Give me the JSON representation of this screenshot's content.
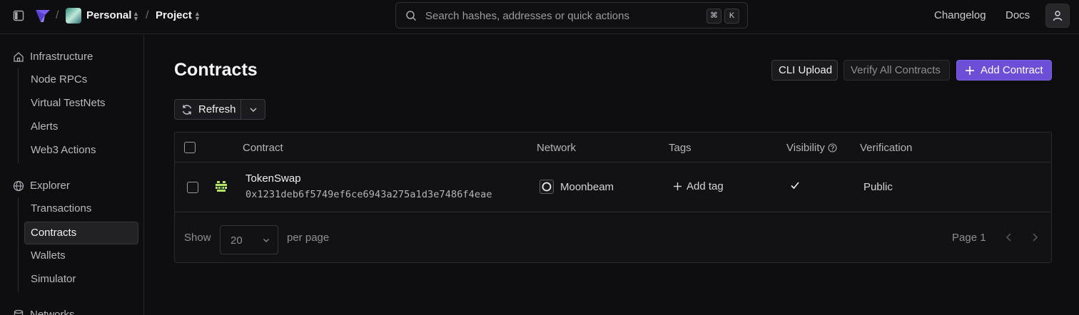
{
  "topbar": {
    "workspace": "Personal",
    "project": "Project",
    "separator": "/",
    "search_placeholder": "Search hashes, addresses or quick actions",
    "shortcut_cmd": "⌘",
    "shortcut_key": "K",
    "changelog": "Changelog",
    "docs": "Docs"
  },
  "sidebar": {
    "infrastructure": {
      "title": "Infrastructure",
      "items": [
        "Node RPCs",
        "Virtual TestNets",
        "Alerts",
        "Web3 Actions"
      ]
    },
    "explorer": {
      "title": "Explorer",
      "items": [
        "Transactions",
        "Contracts",
        "Wallets",
        "Simulator"
      ],
      "active": "Contracts"
    },
    "networks": {
      "title": "Networks"
    }
  },
  "main": {
    "title": "Contracts",
    "buttons": {
      "cli_upload": "CLI Upload",
      "verify_all": "Verify All Contracts",
      "add_contract": "Add Contract"
    },
    "refresh_label": "Refresh",
    "table": {
      "headers": {
        "contract": "Contract",
        "network": "Network",
        "tags": "Tags",
        "visibility": "Visibility",
        "verification": "Verification"
      },
      "rows": [
        {
          "name": "TokenSwap",
          "address": "0x1231deb6f5749ef6ce6943a275a1d3e7486f4eae",
          "network": "Moonbeam",
          "add_tag": "Add tag",
          "verified": true,
          "verification": "Public"
        }
      ]
    },
    "pagination": {
      "show_label": "Show",
      "per_page_value": "20",
      "per_page_label": "per page",
      "page_label": "Page 1"
    }
  },
  "colors": {
    "accent": "#6c4fd6",
    "background": "#0e0e10",
    "panel": "#121214",
    "border": "#2a2a2f"
  }
}
